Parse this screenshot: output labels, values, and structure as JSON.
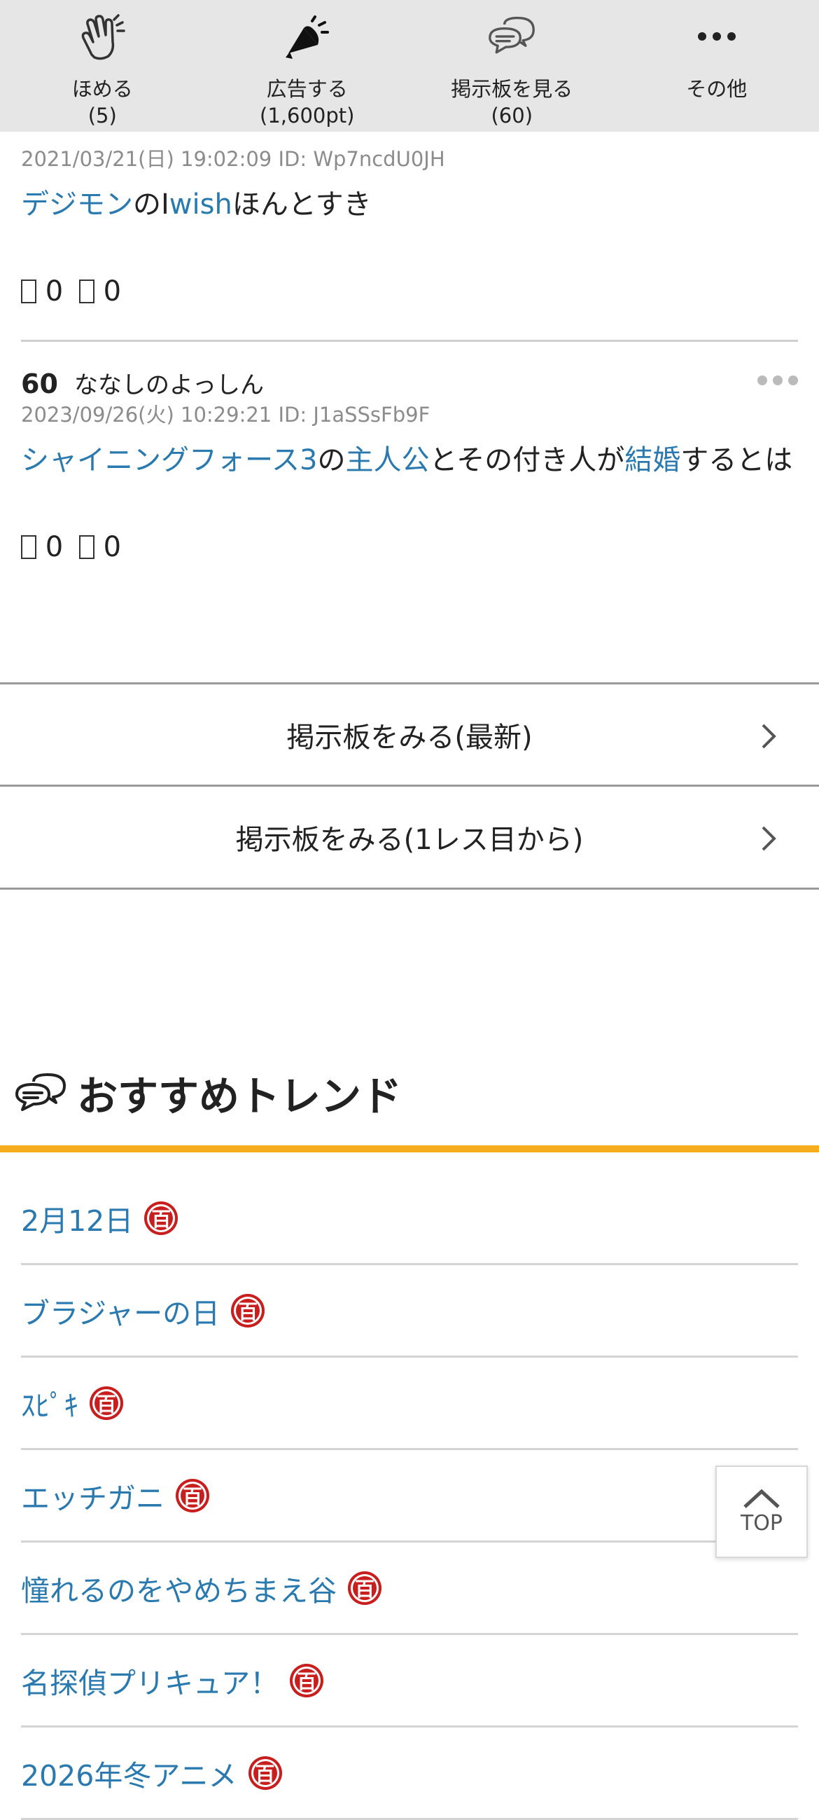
{
  "toolbar": {
    "items": [
      {
        "label": "ほめる",
        "count": "(5)",
        "icon": "clap-icon"
      },
      {
        "label": "広告する",
        "count": "(1,600pt)",
        "icon": "megaphone-icon"
      },
      {
        "label": "掲示板を見る",
        "count": "(60)",
        "icon": "speech-bubbles-icon"
      },
      {
        "label": "その他",
        "count": "",
        "icon": "more-icon"
      }
    ]
  },
  "posts": [
    {
      "meta": "2021/03/21(日) 19:02:09 ID: Wp7ncdU0JH",
      "body": [
        {
          "text": "デジモン",
          "link": true
        },
        {
          "text": "の",
          "link": false
        },
        {
          "text": "I",
          "link": false
        },
        {
          "text": "wish",
          "link": true
        },
        {
          "text": "ほんとすき",
          "link": false
        }
      ],
      "good": "0",
      "bad": "0"
    },
    {
      "number": "60",
      "name": "ななしのよっしん",
      "meta": "2023/09/26(火) 10:29:21 ID: J1aSSsFb9F",
      "body": [
        {
          "text": "シャイニングフォース3",
          "link": true
        },
        {
          "text": "の",
          "link": false
        },
        {
          "text": "主人公",
          "link": true
        },
        {
          "text": "とその付き人が",
          "link": false
        },
        {
          "text": "結婚",
          "link": true
        },
        {
          "text": "するとは",
          "link": false
        }
      ],
      "good": "0",
      "bad": "0"
    }
  ],
  "board_buttons": {
    "latest": "掲示板をみる(最新)",
    "from_first": "掲示板をみる(1レス目から)"
  },
  "trend": {
    "title": "おすすめトレンド",
    "badge": "百",
    "items": [
      "2月12日",
      "ブラジャーの日",
      "ｽﾋﾟｷ",
      "エッチガニ",
      "憧れるのをやめちまえ谷",
      "名探偵プリキュア！",
      "2026年冬アニメ"
    ]
  },
  "top_button": "TOP",
  "colors": {
    "link": "#2a7ab0",
    "accent": "#f6ad1d",
    "badge": "#c81e1e",
    "toolbar_bg": "#e6e6e6"
  }
}
